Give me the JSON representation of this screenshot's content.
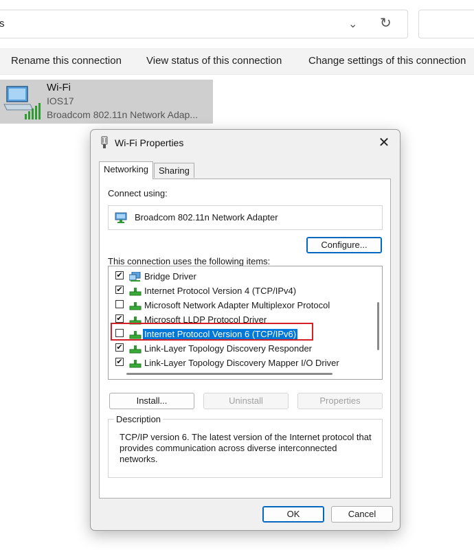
{
  "explorer": {
    "address_text": "s",
    "commands": [
      {
        "label": "Rename this connection"
      },
      {
        "label": "View status of this connection"
      },
      {
        "label": "Change settings of this connection"
      }
    ],
    "connection": {
      "name": "Wi-Fi",
      "ssid": "IOS17",
      "adapter": "Broadcom 802.11n Network Adap..."
    }
  },
  "dialog": {
    "title": "Wi-Fi Properties",
    "tabs": [
      {
        "label": "Networking",
        "active": true
      },
      {
        "label": "Sharing",
        "active": false
      }
    ],
    "connect_using_label": "Connect using:",
    "adapter_name": "Broadcom 802.11n Network Adapter",
    "configure_label": "Configure...",
    "items_label": "This connection uses the following items:",
    "items": [
      {
        "label": "Bridge Driver",
        "checked": true,
        "icon": "bridge-icon"
      },
      {
        "label": "Internet Protocol Version 4 (TCP/IPv4)",
        "checked": true,
        "icon": "protocol-icon"
      },
      {
        "label": "Microsoft Network Adapter Multiplexor Protocol",
        "checked": false,
        "icon": "protocol-icon"
      },
      {
        "label": "Microsoft LLDP Protocol Driver",
        "checked": true,
        "icon": "protocol-icon"
      },
      {
        "label": "Internet Protocol Version 6 (TCP/IPv6)",
        "checked": false,
        "selected": true,
        "icon": "protocol-icon"
      },
      {
        "label": "Link-Layer Topology Discovery Responder",
        "checked": true,
        "icon": "protocol-icon"
      },
      {
        "label": "Link-Layer Topology Discovery Mapper I/O Driver",
        "checked": true,
        "icon": "protocol-icon"
      }
    ],
    "install_label": "Install...",
    "uninstall_label": "Uninstall",
    "properties_label": "Properties",
    "description_title": "Description",
    "description_text": "TCP/IP version 6. The latest version of the Internet protocol that provides communication across diverse interconnected networks.",
    "ok_label": "OK",
    "cancel_label": "Cancel",
    "colors": {
      "selection": "#0078d7",
      "highlight_border": "#d31f26",
      "default_button": "#0067c0"
    }
  }
}
